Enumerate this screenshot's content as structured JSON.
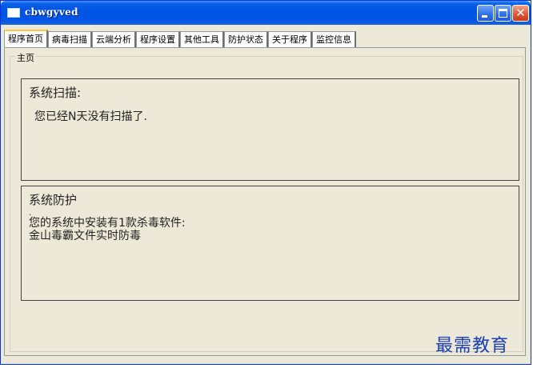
{
  "window": {
    "title": "cbwgyved"
  },
  "tabs": [
    {
      "label": "程序首页",
      "active": true
    },
    {
      "label": "病毒扫描",
      "active": false
    },
    {
      "label": "云端分析",
      "active": false
    },
    {
      "label": "程序设置",
      "active": false
    },
    {
      "label": "其他工具",
      "active": false
    },
    {
      "label": "防护状态",
      "active": false
    },
    {
      "label": "关于程序",
      "active": false
    },
    {
      "label": "监控信息",
      "active": false
    }
  ],
  "home": {
    "group_label": "主页",
    "scan": {
      "heading": "系统扫描:",
      "message": "您已经N天没有扫描了."
    },
    "protection": {
      "heading": "系统防护",
      "marker": ".",
      "line1": "您的系统中安装有1款杀毒软件:",
      "line2": "金山毒霸文件实时防毒"
    }
  },
  "watermark": "最需教育",
  "colors": {
    "titlebar": "#0054e3",
    "window_bg": "#ece9d8",
    "active_tab_accent": "#ffc73c",
    "close_button": "#e0573a",
    "watermark": "#1a3fb8"
  },
  "icons": {
    "app": "window-icon",
    "minimize": "minimize-icon",
    "maximize": "maximize-icon",
    "close": "close-icon"
  }
}
